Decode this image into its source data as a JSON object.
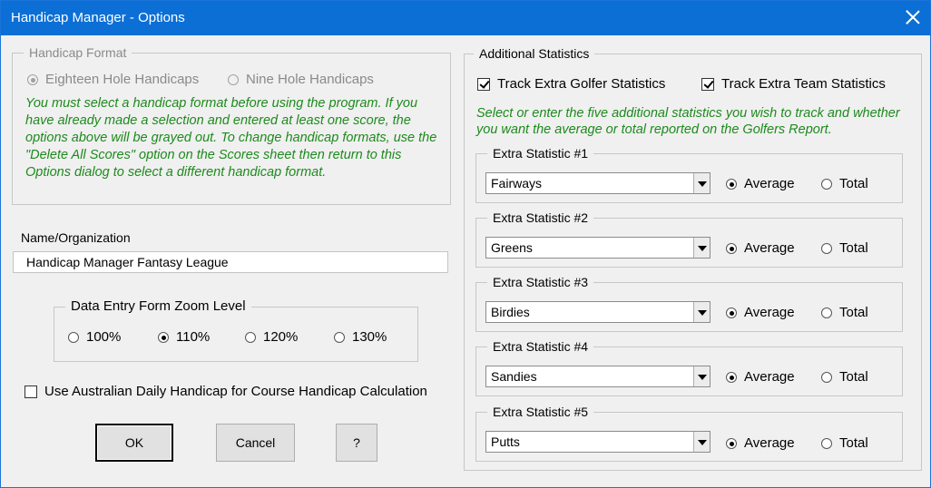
{
  "window": {
    "title": "Handicap Manager - Options"
  },
  "handicap_format": {
    "legend": "Handicap Format",
    "options": [
      "Eighteen Hole Handicaps",
      "Nine Hole Handicaps"
    ],
    "selected": "Eighteen Hole Handicaps",
    "note": "You must select a handicap format before using the program. If you have already made a selection and entered at least one score, the options above will be grayed out. To change handicap formats, use the \"Delete All Scores\" option on the Scores sheet then return to this Options dialog to select a different handicap format."
  },
  "name_org": {
    "label": "Name/Organization",
    "value": "Handicap Manager Fantasy League"
  },
  "zoom": {
    "legend": "Data Entry Form Zoom Level",
    "options": [
      "100%",
      "110%",
      "120%",
      "130%"
    ],
    "selected": "110%"
  },
  "australian": {
    "label": "Use Australian Daily Handicap for Course Handicap Calculation",
    "checked": false
  },
  "buttons": {
    "ok": "OK",
    "cancel": "Cancel",
    "help": "?"
  },
  "additional": {
    "legend": "Additional Statistics",
    "track_golfer": {
      "label": "Track Extra Golfer Statistics",
      "checked": true
    },
    "track_team": {
      "label": "Track Extra Team Statistics",
      "checked": true
    },
    "note": "Select or enter the five additional statistics you wish to track and whether you want the average or total reported on the Golfers Report.",
    "average_label": "Average",
    "total_label": "Total",
    "stats": [
      {
        "legend": "Extra Statistic #1",
        "value": "Fairways",
        "mode": "Average"
      },
      {
        "legend": "Extra Statistic #2",
        "value": "Greens",
        "mode": "Average"
      },
      {
        "legend": "Extra Statistic #3",
        "value": "Birdies",
        "mode": "Average"
      },
      {
        "legend": "Extra Statistic #4",
        "value": "Sandies",
        "mode": "Average"
      },
      {
        "legend": "Extra Statistic #5",
        "value": "Putts",
        "mode": "Average"
      }
    ]
  }
}
